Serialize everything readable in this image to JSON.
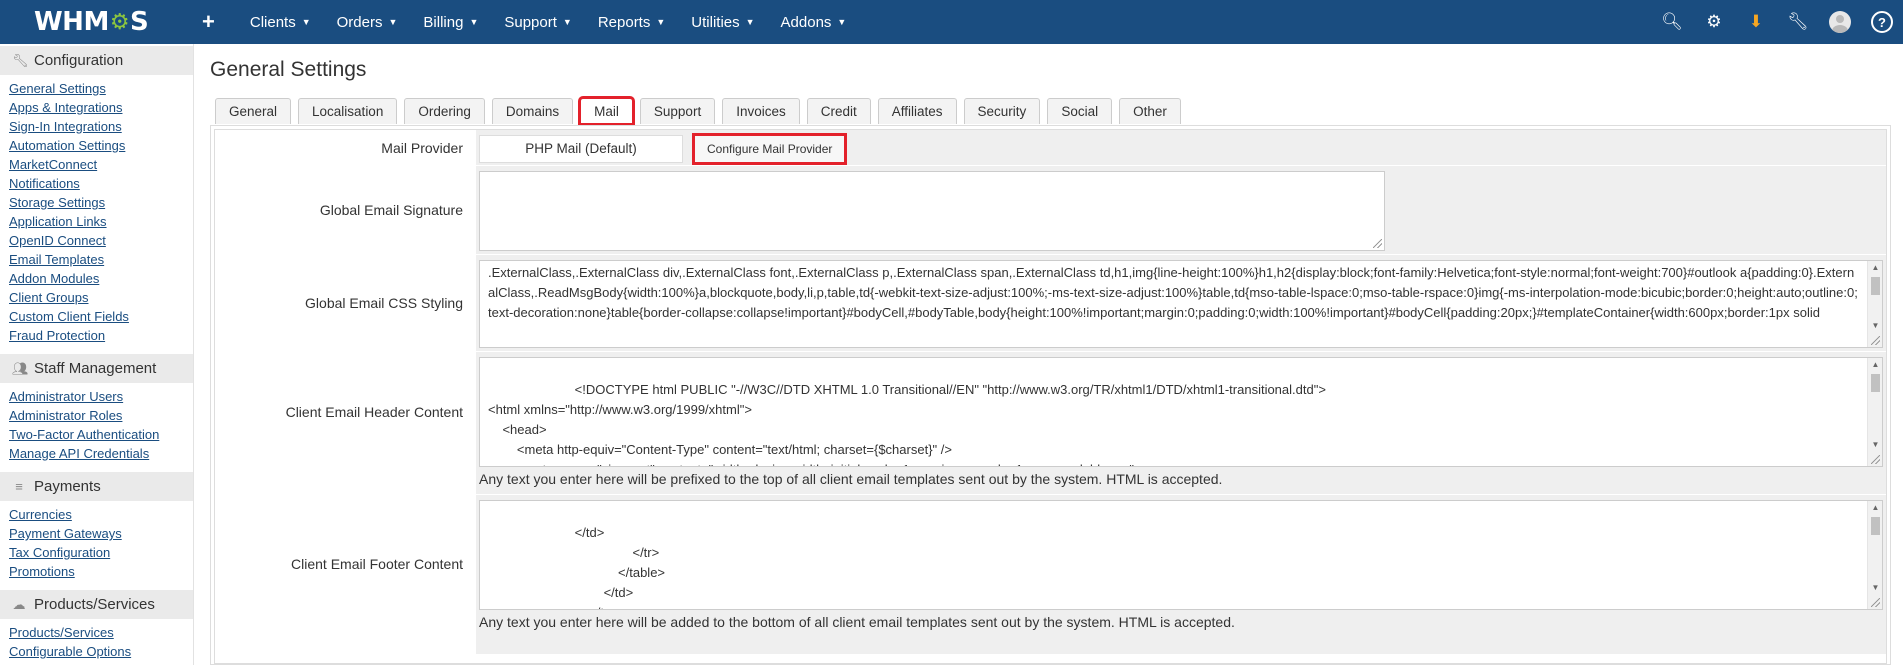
{
  "brand": "WHMCS",
  "nav": {
    "plus": "+",
    "items": [
      "Clients",
      "Orders",
      "Billing",
      "Support",
      "Reports",
      "Utilities",
      "Addons"
    ]
  },
  "sidebar": {
    "sections": [
      {
        "title": "Configuration",
        "icon": "wrench-icon",
        "items": [
          "General Settings",
          "Apps & Integrations",
          "Sign-In Integrations",
          "Automation Settings",
          "MarketConnect",
          "Notifications",
          "Storage Settings",
          "Application Links",
          "OpenID Connect",
          "Email Templates",
          "Addon Modules",
          "Client Groups",
          "Custom Client Fields",
          "Fraud Protection"
        ]
      },
      {
        "title": "Staff Management",
        "icon": "users-icon",
        "items": [
          "Administrator Users",
          "Administrator Roles",
          "Two-Factor Authentication",
          "Manage API Credentials"
        ]
      },
      {
        "title": "Payments",
        "icon": "coins-icon",
        "items": [
          "Currencies",
          "Payment Gateways",
          "Tax Configuration",
          "Promotions"
        ]
      },
      {
        "title": "Products/Services",
        "icon": "cubes-icon",
        "items": [
          "Products/Services",
          "Configurable Options"
        ]
      }
    ]
  },
  "page": {
    "title": "General Settings",
    "tabs": [
      "General",
      "Localisation",
      "Ordering",
      "Domains",
      "Mail",
      "Support",
      "Invoices",
      "Credit",
      "Affiliates",
      "Security",
      "Social",
      "Other"
    ],
    "active_tab": "Mail"
  },
  "form": {
    "mail_provider": {
      "label": "Mail Provider",
      "value": "PHP Mail (Default)",
      "button": "Configure Mail Provider"
    },
    "signature": {
      "label": "Global Email Signature",
      "value": ""
    },
    "css": {
      "label": "Global Email CSS Styling",
      "value": ".ExternalClass,.ExternalClass div,.ExternalClass font,.ExternalClass p,.ExternalClass span,.ExternalClass td,h1,img{line-height:100%}h1,h2{display:block;font-family:Helvetica;font-style:normal;font-weight:700}#outlook a{padding:0}.ExternalClass,.ReadMsgBody{width:100%}a,blockquote,body,li,p,table,td{-webkit-text-size-adjust:100%;-ms-text-size-adjust:100%}table,td{mso-table-lspace:0;mso-table-rspace:0}img{-ms-interpolation-mode:bicubic;border:0;height:auto;outline:0;text-decoration:none}table{border-collapse:collapse!important}#bodyCell,#bodyTable,body{height:100%!important;margin:0;padding:0;width:100%!important}#bodyCell{padding:20px;}#templateContainer{width:600px;border:1px solid"
    },
    "header": {
      "label": "Client Email Header Content",
      "value": "            <!DOCTYPE html PUBLIC \"-//W3C//DTD XHTML 1.0 Transitional//EN\" \"http://www.w3.org/TR/xhtml1/DTD/xhtml1-transitional.dtd\">\n<html xmlns=\"http://www.w3.org/1999/xhtml\">\n    <head>\n        <meta http-equiv=\"Content-Type\" content=\"text/html; charset={$charset}\" />\n        <meta name=\"viewport\" content=\"width=device-width, initial-scale=1, maximum-scale=1, user-scalable=no\">",
      "help": "Any text you enter here will be prefixed to the top of all client email templates sent out by the system. HTML is accepted."
    },
    "footer": {
      "label": "Client Email Footer Content",
      "value": "            </td>\n                                        </tr>\n                                    </table>\n                                </td>\n                            </tr>",
      "help": "Any text you enter here will be added to the bottom of all client email templates sent out by the system. HTML is accepted."
    }
  }
}
